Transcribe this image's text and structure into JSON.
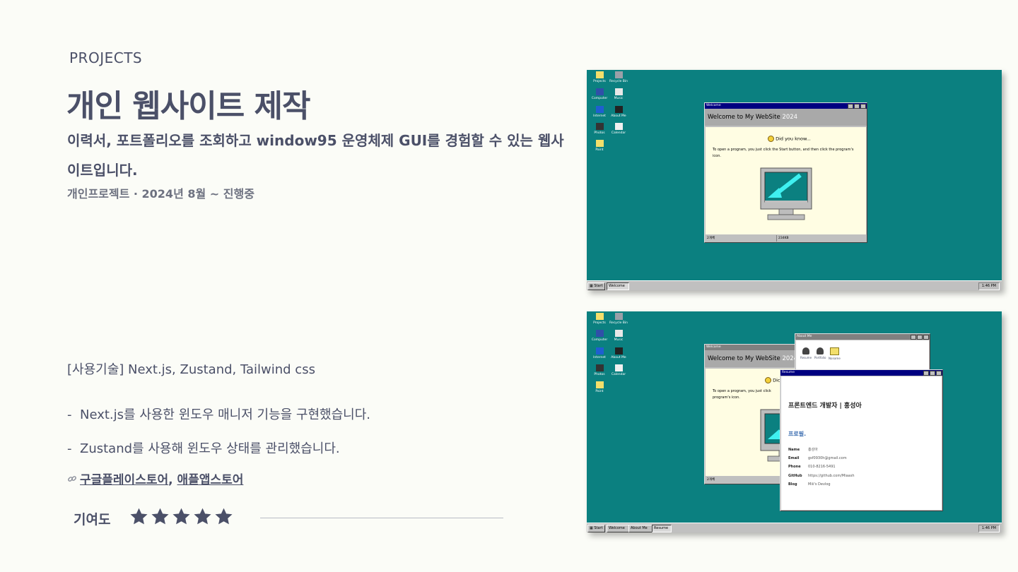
{
  "section_label": "PROJECTS",
  "title": "개인 웹사이트 제작",
  "subtitle": "이력서, 포트폴리오를 조회하고 window95 운영체제 GUI를 경험할 수 있는 웹사이트입니다.",
  "meta": "개인프로젝트 · 2024년 8월 ~ 진행중",
  "tech": "[사용기술] Next.js, Zustand, Tailwind css",
  "bullets": [
    "Next.js를 사용한 윈도우 매니저 기능을 구현했습니다.",
    "Zustand를 사용해 윈도우 상태를 관리했습니다."
  ],
  "bullet_mark": "-",
  "links": {
    "icon": "link-icon",
    "store_1": "구글플레이스토어",
    "separator": ",",
    "store_2": "애플앱스토어"
  },
  "contribution": {
    "label": "기여도",
    "rating": 5,
    "max": 5
  },
  "colors": {
    "text": "#4b5068",
    "desktop": "#0b8080",
    "titlebar": "#000080",
    "welcome_bg": "#fffde3"
  },
  "screenshot_1": {
    "desktop_icons": [
      "Projects",
      "Recycle Bin",
      "Computer",
      "Music",
      "Internet",
      "About Me",
      "Photos",
      "Calendar",
      "Paint"
    ],
    "window_title": "Welcome",
    "welcome_heading": "Welcome to My WebSite",
    "welcome_year": "2024",
    "did_you_know": "Did you know...",
    "tip_text": "To open a program, you just click the Start button, and then click the program's icon.",
    "status_left": "2개체",
    "status_right": "234KB",
    "taskbar": {
      "start": "Start",
      "tasks": [
        "Welcome"
      ],
      "clock": "1:46 PM"
    }
  },
  "screenshot_2": {
    "desktop_icons": [
      "Projects",
      "Recycle Bin",
      "Computer",
      "Music",
      "Internet",
      "About Me",
      "Photos",
      "Calendar",
      "Paint"
    ],
    "welcome_title": "Welcome",
    "welcome_heading": "Welcome to My WebSite",
    "welcome_year": "2024",
    "did_you_know": "Dic",
    "tip_text": "To open a program, you just click program's icon.",
    "status_left": "2개체",
    "about": {
      "title": "About Me",
      "items": [
        "Resume",
        "Portfolio",
        "Noname"
      ]
    },
    "resume": {
      "title": "Resume",
      "heading": "프론트엔드 개발자 | 홍성아",
      "section": "프로필.",
      "rows": [
        {
          "label": "Name",
          "value": "홍성아"
        },
        {
          "label": "Email",
          "value": "gsf0930h@gmail.com"
        },
        {
          "label": "Phone",
          "value": "010-8216-5491"
        },
        {
          "label": "GitHub",
          "value": "https://github.com/Miaash"
        },
        {
          "label": "Blog",
          "value": "Miii's Devlog"
        }
      ]
    },
    "taskbar": {
      "start": "Start",
      "tasks": [
        "Welcome",
        "About Me",
        "Resume"
      ],
      "clock": "1:46 PM"
    }
  }
}
